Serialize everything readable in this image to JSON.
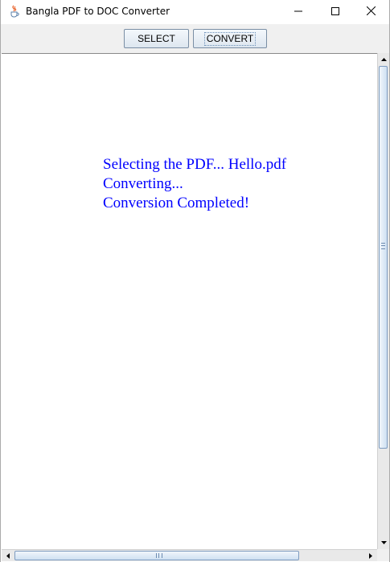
{
  "window": {
    "title": "Bangla PDF to DOC Converter",
    "icon": "java-cup-icon"
  },
  "title_bar_controls": {
    "minimize_icon": "minimize-icon",
    "maximize_icon": "maximize-icon",
    "close_icon": "close-icon"
  },
  "toolbar": {
    "select_label": "SELECT",
    "convert_label": "CONVERT",
    "focused_button": "CONVERT"
  },
  "log": {
    "lines": [
      "Selecting the PDF... Hello.pdf",
      "Converting...",
      "Conversion Completed!"
    ],
    "text_color": "#0000ff"
  },
  "scrollbars": {
    "vertical": {
      "thumb_color": "#cfe0f2"
    },
    "horizontal": {
      "thumb_color": "#cfe0f2"
    }
  }
}
